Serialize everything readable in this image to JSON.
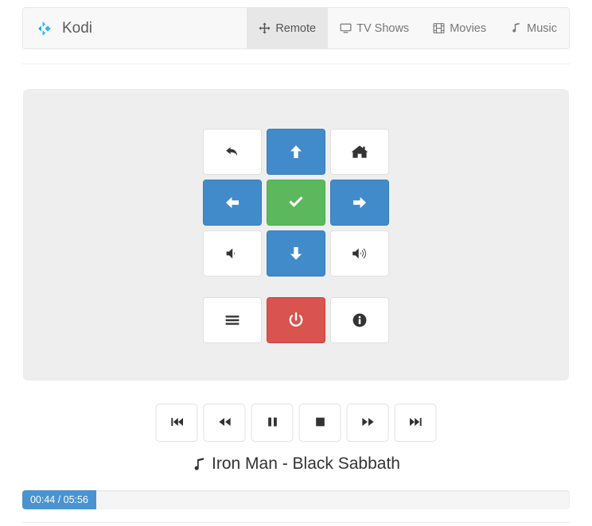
{
  "brand": {
    "name": "Kodi",
    "logo_icon": "kodi-logo-icon",
    "logo_color": "#29b6f6",
    "logo_color_dark": "#0a9fe0"
  },
  "nav": {
    "items": [
      {
        "label": "Remote",
        "icon": "arrows-move-icon",
        "active": true
      },
      {
        "label": "TV Shows",
        "icon": "tv-monitor-icon",
        "active": false
      },
      {
        "label": "Movies",
        "icon": "film-strip-icon",
        "active": false
      },
      {
        "label": "Music",
        "icon": "music-note-icon",
        "active": false
      }
    ]
  },
  "remote": {
    "buttons": [
      {
        "name": "back-button",
        "icon": "back-arrow-icon",
        "style": "default"
      },
      {
        "name": "up-button",
        "icon": "arrow-up-icon",
        "style": "primary"
      },
      {
        "name": "home-button",
        "icon": "home-icon",
        "style": "default"
      },
      {
        "name": "left-button",
        "icon": "arrow-left-icon",
        "style": "primary"
      },
      {
        "name": "select-button",
        "icon": "check-icon",
        "style": "success"
      },
      {
        "name": "right-button",
        "icon": "arrow-right-icon",
        "style": "primary"
      },
      {
        "name": "volume-down-button",
        "icon": "volume-down-icon",
        "style": "default"
      },
      {
        "name": "down-button",
        "icon": "arrow-down-icon",
        "style": "primary"
      },
      {
        "name": "volume-up-button",
        "icon": "volume-up-icon",
        "style": "default"
      },
      {
        "name": "menu-button",
        "icon": "hamburger-menu-icon",
        "style": "default"
      },
      {
        "name": "power-button",
        "icon": "power-icon",
        "style": "danger"
      },
      {
        "name": "info-button",
        "icon": "info-circle-icon",
        "style": "default"
      }
    ]
  },
  "transport": {
    "buttons": [
      {
        "name": "previous-button",
        "icon": "skip-backward-icon"
      },
      {
        "name": "rewind-button",
        "icon": "rewind-icon"
      },
      {
        "name": "pause-button",
        "icon": "pause-icon"
      },
      {
        "name": "stop-button",
        "icon": "stop-icon"
      },
      {
        "name": "fast-forward-button",
        "icon": "fast-forward-icon"
      },
      {
        "name": "next-button",
        "icon": "skip-forward-icon"
      }
    ]
  },
  "now_playing": {
    "icon": "music-note-icon",
    "title": "Iron Man - Black Sabbath"
  },
  "progress": {
    "label": "00:44 / 05:56",
    "elapsed": "00:44",
    "duration": "05:56",
    "percent": 13.5,
    "fill_color": "#4a93d1"
  },
  "colors": {
    "primary": "#428bca",
    "success": "#5cb85c",
    "danger": "#d9534f",
    "panel": "#eeeeee",
    "navbar": "#f8f8f8"
  }
}
